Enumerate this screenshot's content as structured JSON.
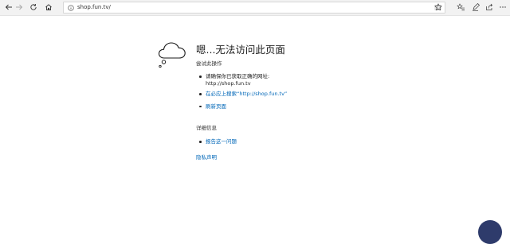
{
  "browser": {
    "address": "shop.fun.tv/"
  },
  "error": {
    "title": "嗯...无法访问此页面",
    "subtitle": "尝试此操作",
    "items": [
      {
        "line1": "请确保你已获取正确的网址:",
        "line2": "http://shop.fun.tv"
      },
      {
        "link": "在必应上搜索“http://shop.fun.tv”"
      },
      {
        "link": "刷新页面"
      }
    ],
    "details_heading": "详细信息",
    "details_items": [
      {
        "link": "报告这一问题"
      }
    ],
    "privacy_link": "隐私声明"
  },
  "colors": {
    "link": "#0067b8",
    "toolbar_bg": "#f2f2f2"
  },
  "icons": [
    "back-icon",
    "forward-icon",
    "refresh-icon",
    "home-icon",
    "info-icon",
    "reading-view-icon",
    "favorite-star-icon",
    "favorites-hub-icon",
    "notes-icon",
    "share-icon",
    "more-icon",
    "cloud-icon"
  ]
}
